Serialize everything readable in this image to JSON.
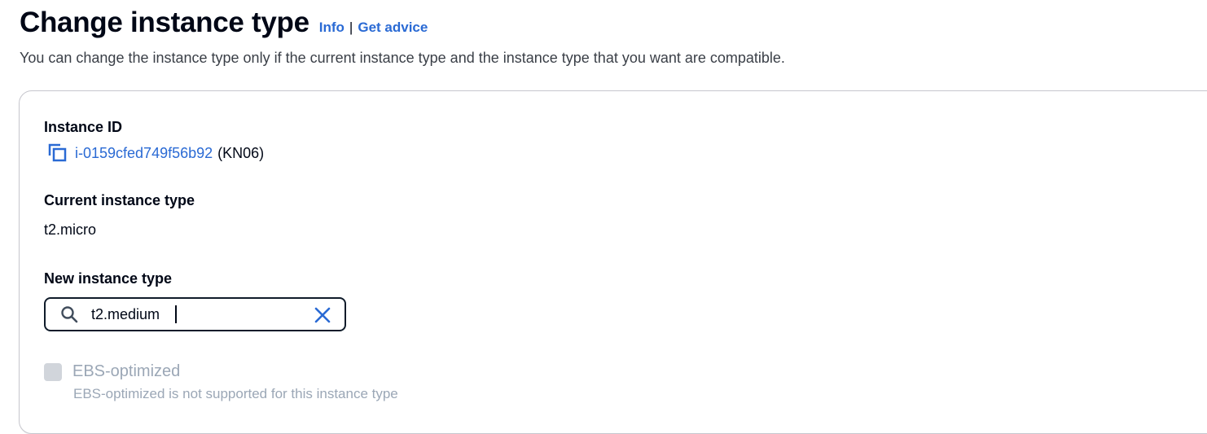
{
  "header": {
    "title": "Change instance type",
    "info_link": "Info",
    "separator": "|",
    "advice_link": "Get advice",
    "description": "You can change the instance type only if the current instance type and the instance type that you want are compatible."
  },
  "instance": {
    "label": "Instance ID",
    "id": "i-0159cfed749f56b92",
    "name": "(KN06)",
    "copy_icon": "copy-icon"
  },
  "current_type": {
    "label": "Current instance type",
    "value": "t2.micro"
  },
  "new_type": {
    "label": "New instance type",
    "search_value": "t2.medium",
    "search_icon": "search-icon",
    "clear_icon": "close-icon"
  },
  "ebs": {
    "label": "EBS-optimized",
    "description": "EBS-optimized is not supported for this instance type",
    "checked": false,
    "disabled": true
  },
  "colors": {
    "link": "#2a6ad4",
    "border": "#0f1b2a",
    "disabled_text": "#9ba7b6"
  }
}
